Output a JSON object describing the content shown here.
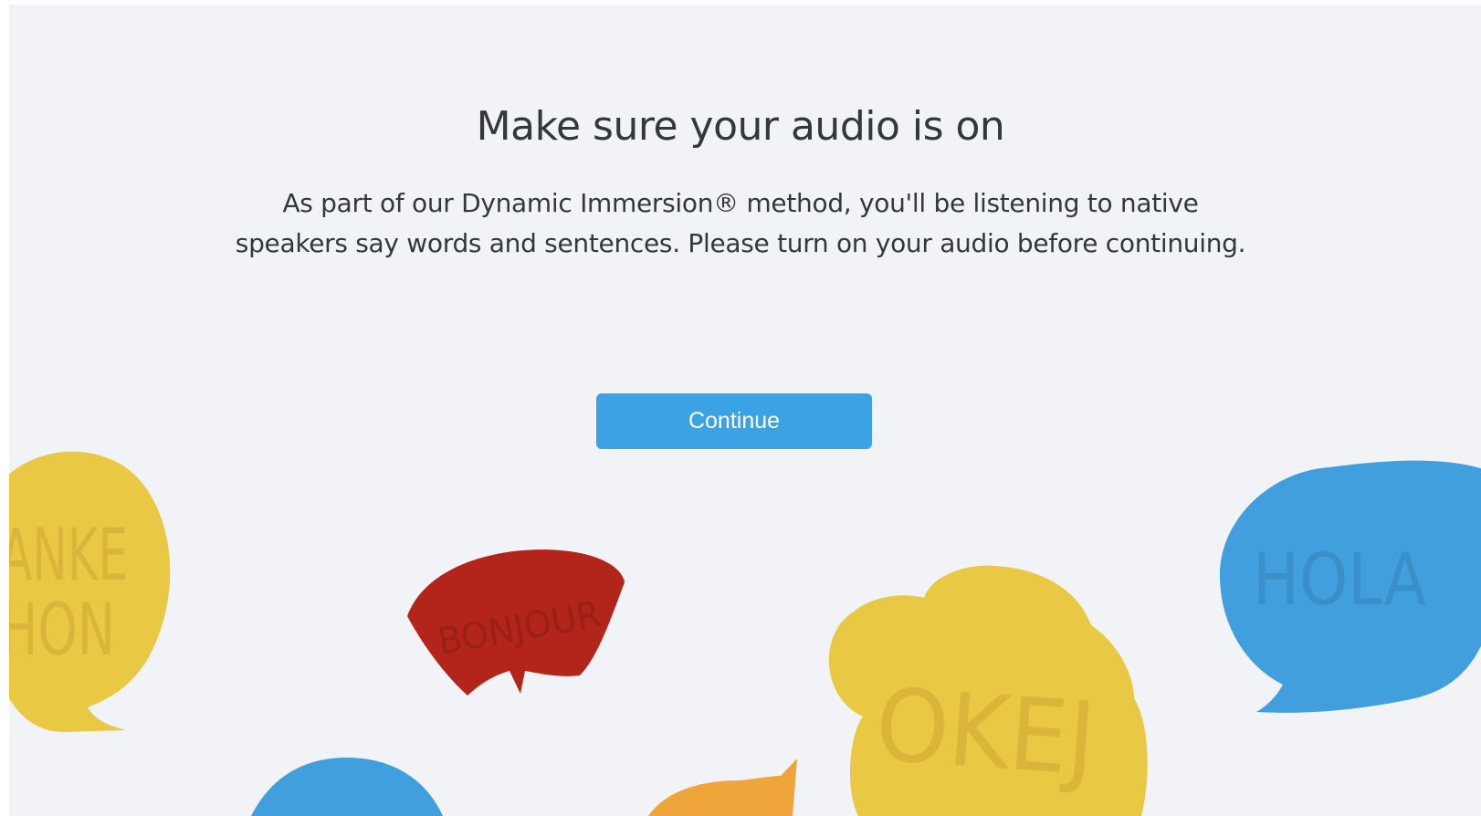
{
  "heading": "Make sure your audio is on",
  "description": "As part of our Dynamic Immersion® method, you'll be listening to native speakers say words and sentences. Please turn on your audio before continuing.",
  "continue_label": "Continue",
  "bubbles": {
    "danke_line1": "ANKE",
    "danke_line2": "HON",
    "bonjour": "BONJOUR",
    "okej": "OKEJ",
    "hola": "HOLA"
  },
  "colors": {
    "background": "#f1f3f6",
    "text": "#33383d",
    "button": "#3ba3e4",
    "yellow": "#e9c843",
    "red": "#b3251b",
    "blue": "#429fdd",
    "orange": "#efa53a"
  }
}
